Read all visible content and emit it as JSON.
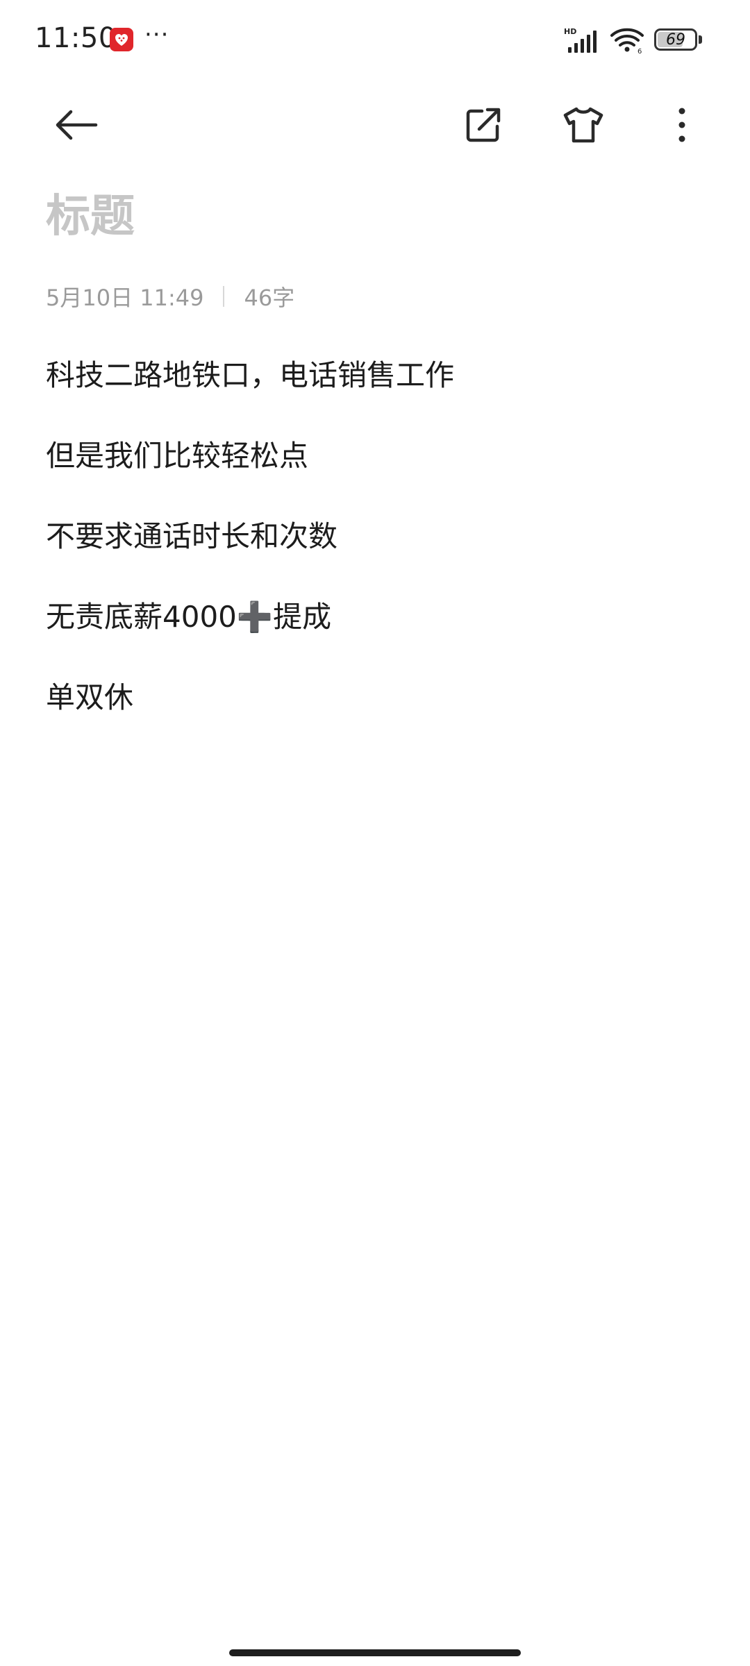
{
  "status_bar": {
    "time": "11:50",
    "more_indicator": "···",
    "signal_label": "HD",
    "battery_level": "69",
    "battery_percent": 69,
    "app_notification_icon": "pinduoduo-app-icon",
    "app_notification_color": "#e0262b"
  },
  "toolbar": {
    "back_icon": "arrow-left-icon",
    "share_icon": "share-external-icon",
    "skin_icon": "tshirt-icon",
    "menu_icon": "more-vertical-icon"
  },
  "note": {
    "title_placeholder": "标题",
    "date": "5月10日 11:49",
    "char_count": "46字",
    "lines": [
      "科技二路地铁口，电话销售工作",
      "但是我们比较轻松点",
      "不要求通话时长和次数",
      "无责底薪4000➕提成",
      "单双休"
    ]
  },
  "colors": {
    "text": "#1c1c1c",
    "placeholder": "#c6c6c6",
    "meta": "#9a9a9a",
    "background": "#ffffff"
  }
}
